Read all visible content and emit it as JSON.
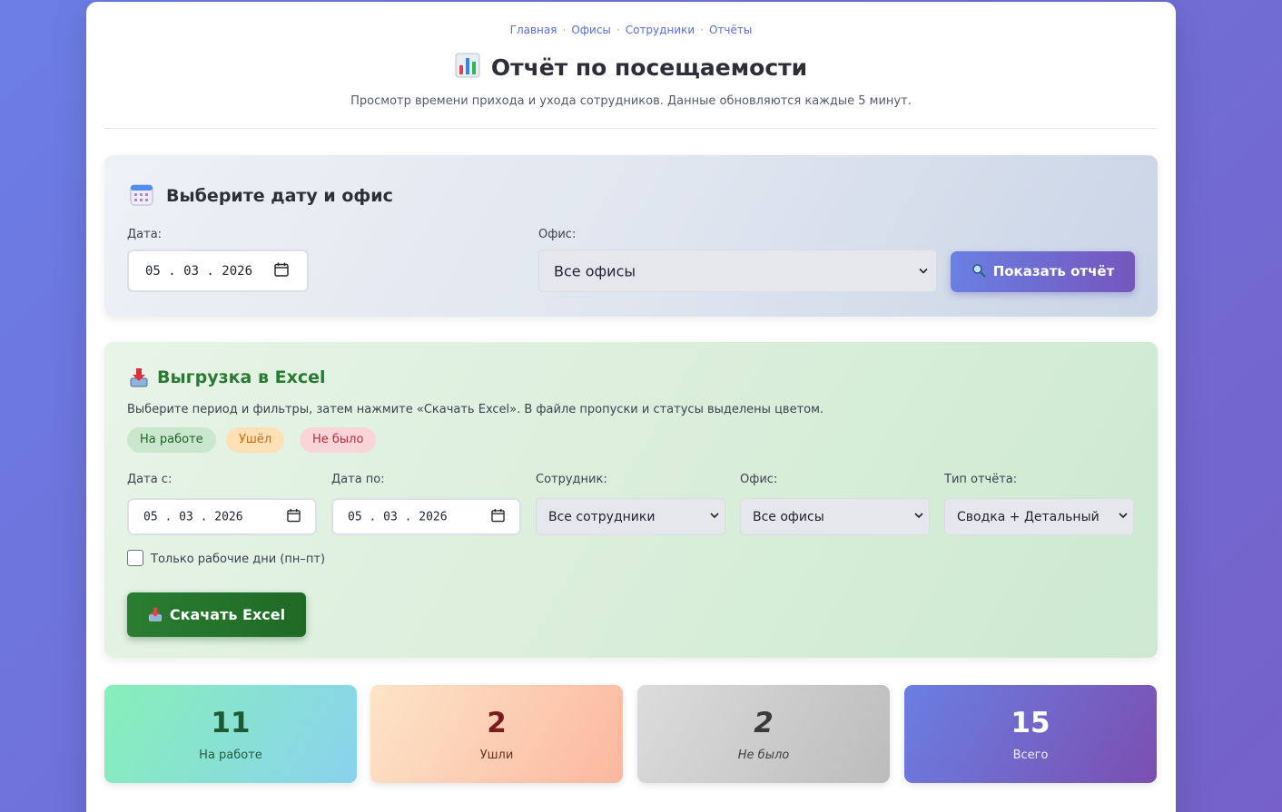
{
  "nav": {
    "items": [
      "Главная",
      "Офисы",
      "Сотрудники",
      "Отчёты"
    ],
    "separator": "·"
  },
  "header": {
    "title": "Отчёт по посещаемости",
    "title_icon": "bar-chart-icon",
    "subtitle": "Просмотр времени прихода и ухода сотрудников. Данные обновляются каждые 5 минут."
  },
  "filter": {
    "heading": "Выберите дату и офис",
    "heading_icon": "calendar-icon",
    "date_label": "Дата:",
    "date_value": "05 . 03 . 2026",
    "office_label": "Офис:",
    "office_value": "Все офисы",
    "show_button": "Показать отчёт",
    "show_button_icon": "magnifier-icon"
  },
  "export": {
    "heading": "Выгрузка в Excel",
    "heading_icon": "inbox-tray-icon",
    "description": "Выберите период и фильтры, затем нажмите «Скачать Excel». В файле пропуски и статусы выделены цветом.",
    "legend": {
      "at_work": "На работе",
      "left": "Ушёл",
      "absent": "Не было"
    },
    "date_from_label": "Дата с:",
    "date_from_value": "05 . 03 . 2026",
    "date_to_label": "Дата по:",
    "date_to_value": "05 . 03 . 2026",
    "employee_label": "Сотрудник:",
    "employee_value": "Все сотрудники",
    "office_label": "Офис:",
    "office_value": "Все офисы",
    "report_type_label": "Тип отчёта:",
    "report_type_value": "Сводка + Детальный",
    "workdays_only_label": "Только рабочие дни (пн–пт)",
    "workdays_only_checked": false,
    "download_button": "Скачать Excel"
  },
  "stats": [
    {
      "value": "11",
      "label": "На работе"
    },
    {
      "value": "2",
      "label": "Ушли"
    },
    {
      "value": "2",
      "label": "Не было"
    },
    {
      "value": "15",
      "label": "Всего"
    }
  ]
}
